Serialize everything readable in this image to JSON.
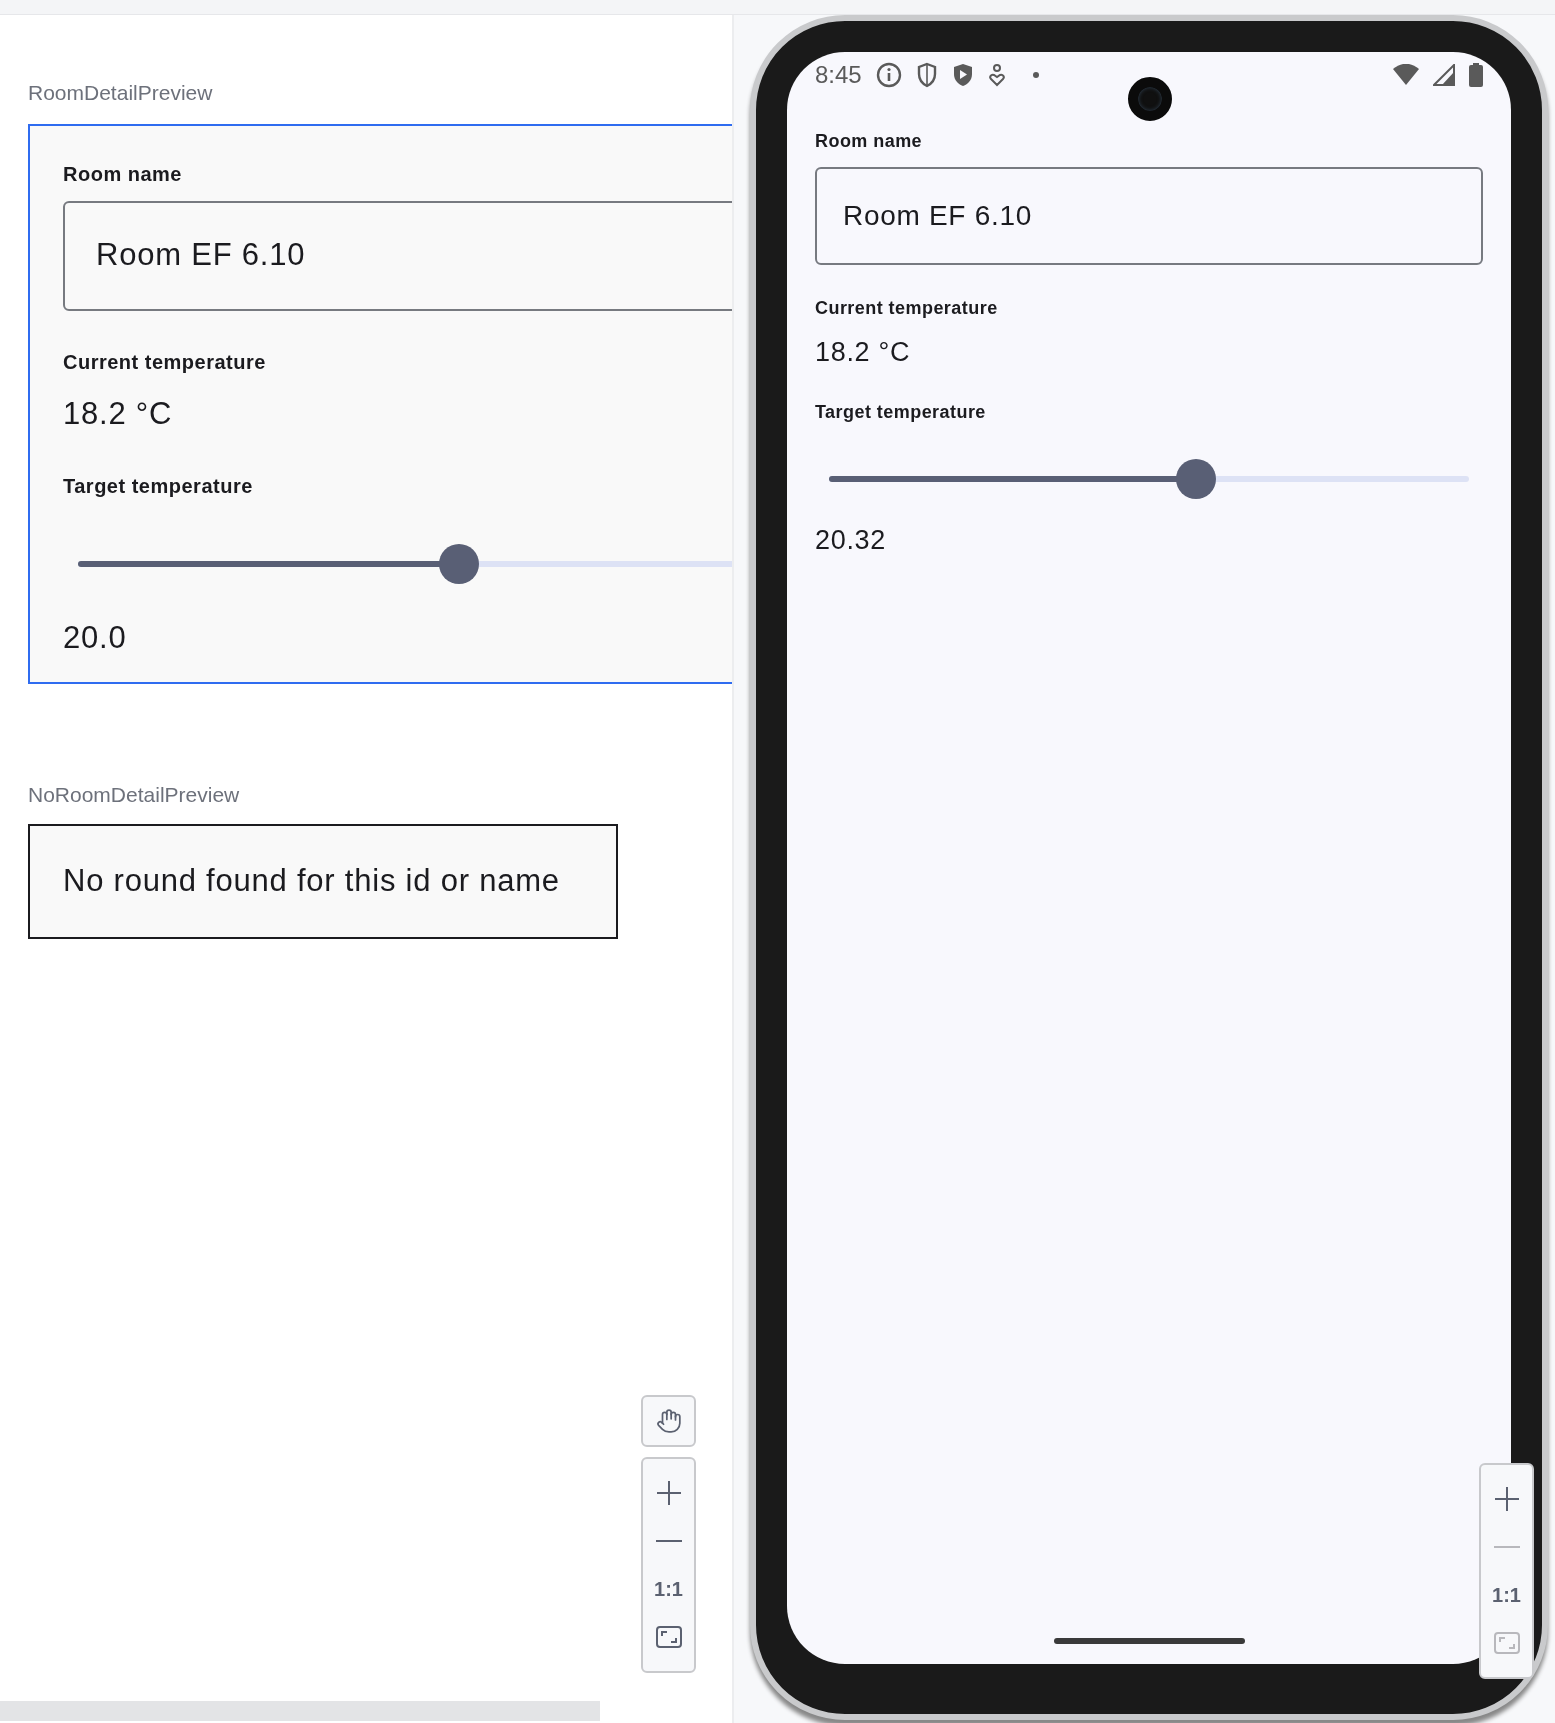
{
  "previews": [
    {
      "kind": "room_detail",
      "title": "RoomDetailPreview",
      "selected": true,
      "room_name_label": "Room name",
      "room_name": "Room EF 6.10",
      "current_label": "Current temperature",
      "current_value": "18.2 °C",
      "target_label": "Target temperature",
      "slider": {
        "level": 0.577
      },
      "target_value": "20.0"
    },
    {
      "kind": "message",
      "title": "NoRoomDetailPreview",
      "selected": false,
      "message": "No round found for this id or name"
    }
  ],
  "canvas_controls": [
    {
      "kind": "pan",
      "disabled": false
    },
    {
      "kind": "zoom_in",
      "disabled": false
    },
    {
      "kind": "zoom_out",
      "disabled": false
    },
    {
      "kind": "actual_size",
      "label": "1:1",
      "disabled": false
    },
    {
      "kind": "fit",
      "disabled": false
    }
  ],
  "device": {
    "status_bar": {
      "time": "8:45"
    },
    "room_name_label": "Room name",
    "room_name": "Room EF 6.10",
    "current_label": "Current temperature",
    "current_value": "18.2 °C",
    "target_label": "Target temperature",
    "slider": {
      "level": 0.574
    },
    "target_value": "20.32"
  },
  "device_controls": [
    {
      "kind": "zoom_in",
      "disabled": false
    },
    {
      "kind": "zoom_out",
      "disabled": true
    },
    {
      "kind": "actual_size",
      "label": "1:1",
      "disabled": false
    },
    {
      "kind": "fit",
      "disabled": true
    }
  ]
}
